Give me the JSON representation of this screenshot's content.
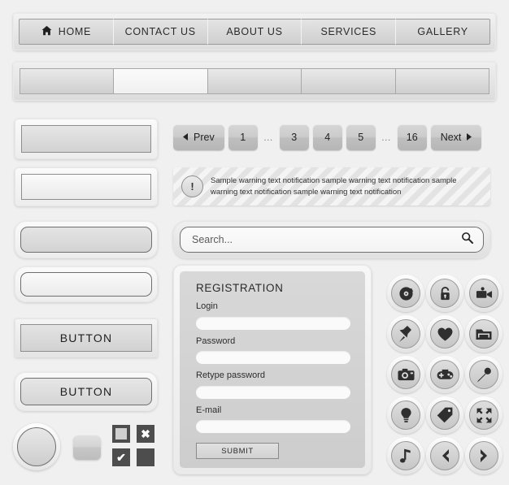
{
  "topnav": {
    "items": [
      {
        "label": "HOME",
        "icon": "home-icon"
      },
      {
        "label": "CONTACT US",
        "icon": ""
      },
      {
        "label": "ABOUT US",
        "icon": ""
      },
      {
        "label": "SERVICES",
        "icon": ""
      },
      {
        "label": "GALLERY",
        "icon": ""
      }
    ]
  },
  "menubar": {
    "cells": [
      "",
      "",
      "",
      "",
      ""
    ],
    "active_index": 1
  },
  "pagination": {
    "prev_label": "Prev",
    "next_label": "Next",
    "prev_icon": "chevron-left-icon",
    "next_icon": "chevron-right-icon",
    "pages": [
      "1",
      "…",
      "3",
      "4",
      "5",
      "…",
      "16"
    ]
  },
  "warning": {
    "icon": "exclamation-circle-icon",
    "text": "Sample warning text notification sample warning text notification sample warning text notification sample warning text notification"
  },
  "search": {
    "placeholder": "Search...",
    "value": "",
    "icon": "search-icon"
  },
  "registration": {
    "title": "REGISTRATION",
    "fields": [
      {
        "label": "Login",
        "value": "",
        "placeholder": ""
      },
      {
        "label": "Password",
        "value": "",
        "placeholder": ""
      },
      {
        "label": "Retype password",
        "value": "",
        "placeholder": ""
      },
      {
        "label": "E-mail",
        "value": "",
        "placeholder": ""
      }
    ],
    "submit_label": "SUBMIT"
  },
  "buttons": {
    "square_label": "BUTTON",
    "round_label": "BUTTON"
  },
  "checkboxes": [
    {
      "name": "checkbox-filled",
      "glyph": ""
    },
    {
      "name": "checkbox-cross",
      "glyph": "✖"
    },
    {
      "name": "checkbox-check",
      "glyph": "✔"
    },
    {
      "name": "checkbox-solid",
      "glyph": ""
    }
  ],
  "icons": [
    {
      "name": "disc-icon"
    },
    {
      "name": "lock-icon"
    },
    {
      "name": "video-camera-icon"
    },
    {
      "name": "pin-icon"
    },
    {
      "name": "heart-icon"
    },
    {
      "name": "folder-icon"
    },
    {
      "name": "camera-icon"
    },
    {
      "name": "gamepad-icon"
    },
    {
      "name": "microphone-icon"
    },
    {
      "name": "lightbulb-icon"
    },
    {
      "name": "tag-icon"
    },
    {
      "name": "expand-icon"
    },
    {
      "name": "music-note-icon"
    },
    {
      "name": "arrow-left-icon"
    },
    {
      "name": "arrow-right-icon"
    }
  ],
  "colors": {
    "background": "#f0f0f0",
    "panel": "#d8d8d8",
    "border": "#8d8d8d",
    "text": "#2b2b2b",
    "icon_dark": "#4d4d4d"
  }
}
